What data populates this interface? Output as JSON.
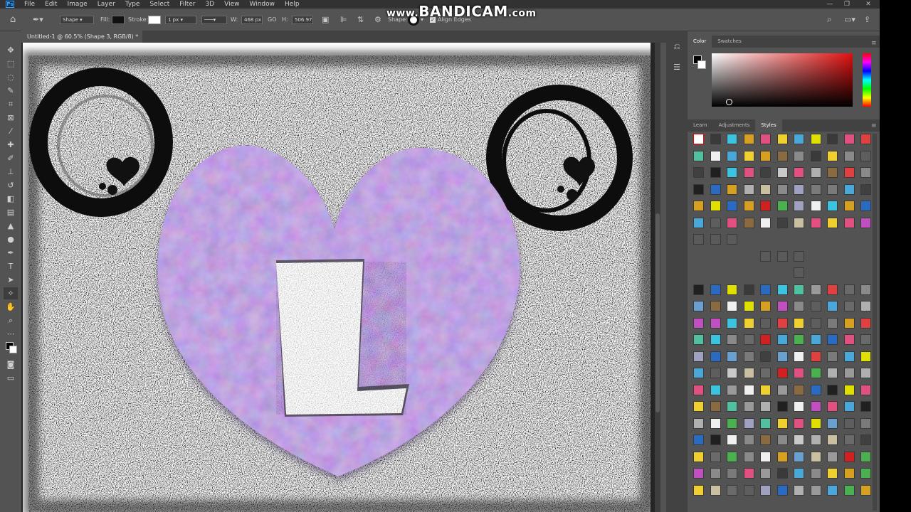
{
  "watermark": {
    "text_prefix": "www.",
    "text_brand": "BANDICAM",
    "text_suffix": ".com"
  },
  "menu": [
    "File",
    "Edit",
    "Image",
    "Layer",
    "Type",
    "Select",
    "Filter",
    "3D",
    "View",
    "Window",
    "Help"
  ],
  "options": {
    "mode": "Shape",
    "fill_label": "Fill:",
    "stroke_label": "Stroke:",
    "stroke_width": "1 px",
    "w_label": "W:",
    "w_value": "468 px",
    "link_label": "GO",
    "h_label": "H:",
    "h_value": "506.97",
    "shape_label": "Shape:",
    "align_edges_label": "Align Edges"
  },
  "document": {
    "tab_title": "Untitled-1 @ 60.5% (Shape 3, RGB/8) *",
    "close": "×"
  },
  "panels": {
    "color_tabs": [
      "Color",
      "Swatches"
    ],
    "styles_tabs": [
      "Learn",
      "Adjustments",
      "Styles"
    ]
  },
  "colors": {
    "fill": "#111111",
    "heart": "#8a5fd0",
    "accent": "#31a8ff"
  }
}
